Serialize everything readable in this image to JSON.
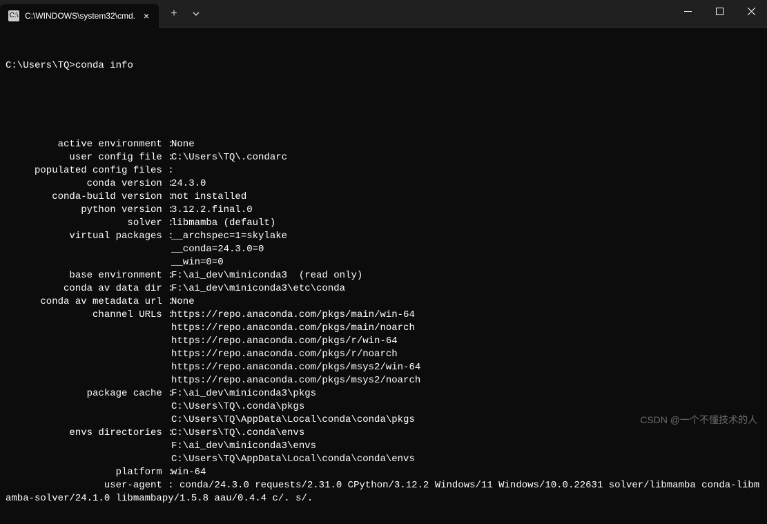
{
  "window": {
    "tab_title": "C:\\WINDOWS\\system32\\cmd."
  },
  "terminal": {
    "prompt": "C:\\Users\\TQ>",
    "command": "conda info",
    "info": [
      {
        "label": "active environment :",
        "values": [
          "None"
        ]
      },
      {
        "label": "user config file :",
        "values": [
          "C:\\Users\\TQ\\.condarc"
        ]
      },
      {
        "label": "populated config files :",
        "values": [
          ""
        ]
      },
      {
        "label": "conda version :",
        "values": [
          "24.3.0"
        ]
      },
      {
        "label": "conda-build version :",
        "values": [
          "not installed"
        ]
      },
      {
        "label": "python version :",
        "values": [
          "3.12.2.final.0"
        ]
      },
      {
        "label": "solver :",
        "values": [
          "libmamba (default)"
        ]
      },
      {
        "label": "virtual packages :",
        "values": [
          "__archspec=1=skylake",
          "__conda=24.3.0=0",
          "__win=0=0"
        ]
      },
      {
        "label": "base environment :",
        "values": [
          "F:\\ai_dev\\miniconda3  (read only)"
        ]
      },
      {
        "label": "conda av data dir :",
        "values": [
          "F:\\ai_dev\\miniconda3\\etc\\conda"
        ]
      },
      {
        "label": "conda av metadata url :",
        "values": [
          "None"
        ]
      },
      {
        "label": "channel URLs :",
        "values": [
          "https://repo.anaconda.com/pkgs/main/win-64",
          "https://repo.anaconda.com/pkgs/main/noarch",
          "https://repo.anaconda.com/pkgs/r/win-64",
          "https://repo.anaconda.com/pkgs/r/noarch",
          "https://repo.anaconda.com/pkgs/msys2/win-64",
          "https://repo.anaconda.com/pkgs/msys2/noarch"
        ]
      },
      {
        "label": "package cache :",
        "values": [
          "F:\\ai_dev\\miniconda3\\pkgs",
          "C:\\Users\\TQ\\.conda\\pkgs",
          "C:\\Users\\TQ\\AppData\\Local\\conda\\conda\\pkgs"
        ]
      },
      {
        "label": "envs directories :",
        "values": [
          "C:\\Users\\TQ\\.conda\\envs",
          "F:\\ai_dev\\miniconda3\\envs",
          "C:\\Users\\TQ\\AppData\\Local\\conda\\conda\\envs"
        ]
      },
      {
        "label": "platform :",
        "values": [
          "win-64"
        ]
      },
      {
        "label": "user-agent :",
        "values": [
          "conda/24.3.0 requests/2.31.0 CPython/3.12.2 Windows/11 Windows/10.0.22631 solver/libmamba conda-libmamba-solver/24.1.0 libmambapy/1.5.8 aau/0.4.4 c/. s/."
        ]
      }
    ]
  },
  "watermark": "CSDN @一个不懂技术的人"
}
